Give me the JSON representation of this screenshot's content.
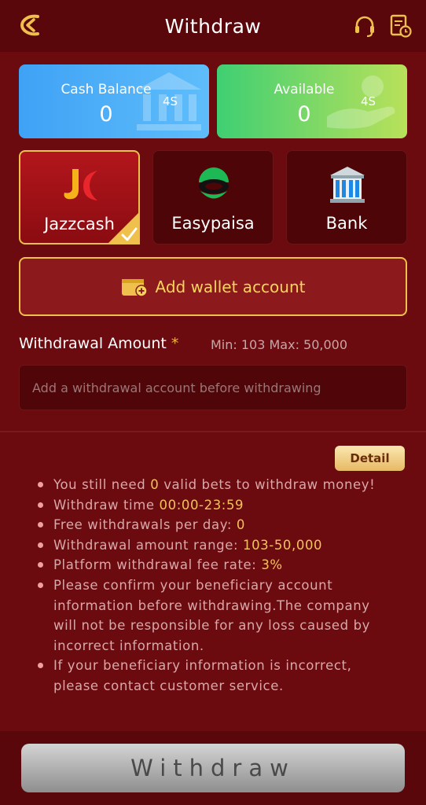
{
  "header": {
    "title": "Withdraw"
  },
  "balances": {
    "cash": {
      "label": "Cash Balance",
      "value": "0",
      "tag": "4S"
    },
    "available": {
      "label": "Available",
      "value": "0",
      "tag": "4S"
    }
  },
  "methods": [
    {
      "name": "Jazzcash",
      "selected": true,
      "icon": "jazzcash-logo"
    },
    {
      "name": "Easypaisa",
      "selected": false,
      "icon": "easypaisa-logo"
    },
    {
      "name": "Bank",
      "selected": false,
      "icon": "bank-building-icon"
    }
  ],
  "add_wallet": {
    "label": "Add wallet account"
  },
  "amount": {
    "label": "Withdrawal Amount",
    "required_mark": "*",
    "range": "Min: 103 Max: 50,000",
    "placeholder": "Add a withdrawal account before withdrawing"
  },
  "detail_button": "Detail",
  "rules": {
    "r1_a": "You still need ",
    "r1_b": "0",
    "r1_c": " valid bets to withdraw money!",
    "r2_a": "Withdraw time ",
    "r2_b": "00:00-23:59",
    "r3_a": "Free withdrawals per day: ",
    "r3_b": "0",
    "r4_a": "Withdrawal amount range: ",
    "r4_b": "103-50,000",
    "r5_a": "Platform withdrawal fee rate: ",
    "r5_b": "3%",
    "r6": "Please confirm your beneficiary account information before withdrawing.The company will not be responsible for any loss caused by incorrect information.",
    "r7": "If your beneficiary information is incorrect, please contact customer service."
  },
  "withdraw_button": "Withdraw",
  "colors": {
    "accent": "#f0c04d",
    "background": "#6b0a0f",
    "highlight": "#f2c35a"
  }
}
